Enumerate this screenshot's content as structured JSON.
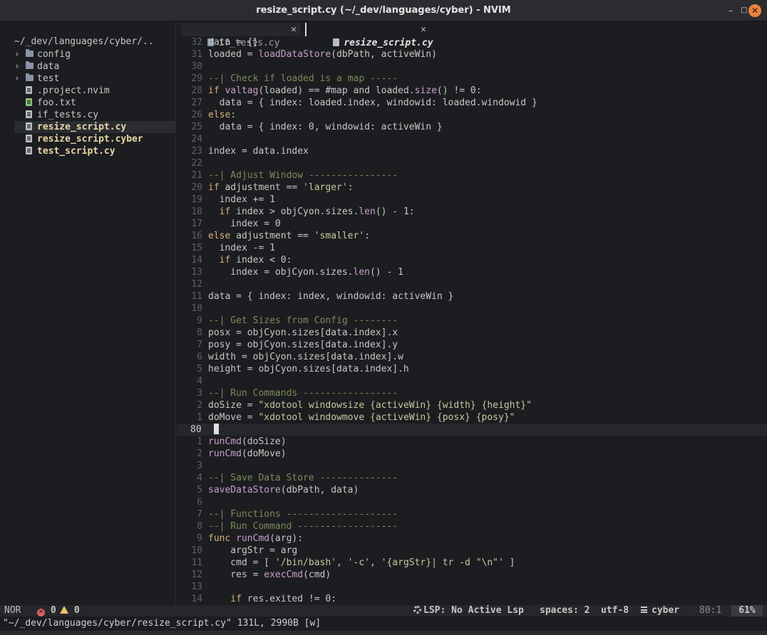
{
  "window": {
    "title": "resize_script.cy (~/_dev/languages/cyber) - NVIM",
    "min_glyph": "–",
    "max_glyph": "□",
    "close_glyph": "✕"
  },
  "tree": {
    "root": "~/_dev/languages/cyber/..",
    "items": [
      {
        "type": "folder",
        "label": "config",
        "chev": "›"
      },
      {
        "type": "folder",
        "label": "data",
        "chev": "›"
      },
      {
        "type": "folder",
        "label": "test",
        "chev": "›"
      },
      {
        "type": "file",
        "label": ".project.nvim",
        "style": "plain"
      },
      {
        "type": "file",
        "label": "foo.txt",
        "style": "plain"
      },
      {
        "type": "file",
        "label": "if_tests.cy",
        "style": "plain"
      },
      {
        "type": "file",
        "label": "resize_script.cy",
        "style": "bold"
      },
      {
        "type": "file",
        "label": "resize_script.cyber",
        "style": "bold"
      },
      {
        "type": "file",
        "label": "test_script.cy",
        "style": "bold"
      }
    ]
  },
  "tabs": [
    {
      "label": "if_tests.cy",
      "close": "✕"
    },
    {
      "label": "resize_script.cy",
      "close": "✕"
    }
  ],
  "editor": {
    "lines": [
      {
        "n": "32",
        "tokens": [
          [
            "plain",
            "data = {}"
          ]
        ]
      },
      {
        "n": "31",
        "tokens": [
          [
            "plain",
            "loaded = "
          ],
          [
            "fn",
            "loadDataStore"
          ],
          [
            "plain",
            "(dbPath, activeWin)"
          ]
        ]
      },
      {
        "n": "30",
        "tokens": []
      },
      {
        "n": "29",
        "tokens": [
          [
            "com",
            "--| Check if loaded is a map -----"
          ]
        ]
      },
      {
        "n": "28",
        "tokens": [
          [
            "kw",
            "if "
          ],
          [
            "fn",
            "valtag"
          ],
          [
            "plain",
            "(loaded) == #map and loaded."
          ],
          [
            "fn",
            "size"
          ],
          [
            "plain",
            "() != 0:"
          ]
        ]
      },
      {
        "n": "27",
        "tokens": [
          [
            "plain",
            "  data = { index: loaded.index, windowid: loaded.windowid }"
          ]
        ]
      },
      {
        "n": "26",
        "tokens": [
          [
            "kw",
            "else"
          ],
          [
            "plain",
            ":"
          ]
        ]
      },
      {
        "n": "25",
        "tokens": [
          [
            "plain",
            "  data = { index: 0, windowid: activeWin }"
          ]
        ]
      },
      {
        "n": "24",
        "tokens": []
      },
      {
        "n": "23",
        "tokens": [
          [
            "plain",
            "index = data.index"
          ]
        ]
      },
      {
        "n": "22",
        "tokens": []
      },
      {
        "n": "21",
        "tokens": [
          [
            "com",
            "--| Adjust Window ----------------"
          ]
        ]
      },
      {
        "n": "20",
        "tokens": [
          [
            "kw",
            "if "
          ],
          [
            "plain",
            "adjustment == "
          ],
          [
            "str",
            "'larger'"
          ],
          [
            "plain",
            ":"
          ]
        ]
      },
      {
        "n": "19",
        "tokens": [
          [
            "plain",
            "  index += 1"
          ]
        ]
      },
      {
        "n": "18",
        "tokens": [
          [
            "kw",
            "  if "
          ],
          [
            "plain",
            "index > objCyon.sizes."
          ],
          [
            "fn",
            "len"
          ],
          [
            "plain",
            "() - 1:"
          ]
        ]
      },
      {
        "n": "17",
        "tokens": [
          [
            "plain",
            "    index = 0"
          ]
        ]
      },
      {
        "n": "16",
        "tokens": [
          [
            "kw",
            "else "
          ],
          [
            "plain",
            "adjustment == "
          ],
          [
            "str",
            "'smaller'"
          ],
          [
            "plain",
            ":"
          ]
        ]
      },
      {
        "n": "15",
        "tokens": [
          [
            "plain",
            "  index -= 1"
          ]
        ]
      },
      {
        "n": "14",
        "tokens": [
          [
            "kw",
            "  if "
          ],
          [
            "plain",
            "index < 0:"
          ]
        ]
      },
      {
        "n": "13",
        "tokens": [
          [
            "plain",
            "    index = objCyon.sizes."
          ],
          [
            "fn",
            "len"
          ],
          [
            "plain",
            "() - 1"
          ]
        ]
      },
      {
        "n": "12",
        "tokens": []
      },
      {
        "n": "11",
        "tokens": [
          [
            "plain",
            "data = { index: index, windowid: activeWin }"
          ]
        ]
      },
      {
        "n": "10",
        "tokens": []
      },
      {
        "n": "9",
        "tokens": [
          [
            "com",
            "--| Get Sizes from Config --------"
          ]
        ]
      },
      {
        "n": "8",
        "tokens": [
          [
            "plain",
            "posx = objCyon.sizes[data.index].x"
          ]
        ]
      },
      {
        "n": "7",
        "tokens": [
          [
            "plain",
            "posy = objCyon.sizes[data.index].y"
          ]
        ]
      },
      {
        "n": "6",
        "tokens": [
          [
            "plain",
            "width = objCyon.sizes[data.index].w"
          ]
        ]
      },
      {
        "n": "5",
        "tokens": [
          [
            "plain",
            "height = objCyon.sizes[data.index].h"
          ]
        ]
      },
      {
        "n": "4",
        "tokens": []
      },
      {
        "n": "3",
        "tokens": [
          [
            "com",
            "--| Run Commands -----------------"
          ]
        ]
      },
      {
        "n": "2",
        "tokens": [
          [
            "plain",
            "doSize = "
          ],
          [
            "str",
            "\"xdotool windowsize {activeWin} {width} {height}\""
          ]
        ]
      },
      {
        "n": "1",
        "tokens": [
          [
            "plain",
            "doMove = "
          ],
          [
            "str",
            "\"xdotool windowmove {activeWin} {posx} {posy}\""
          ]
        ]
      },
      {
        "n": "80",
        "tokens": [],
        "cursor": true
      },
      {
        "n": "1",
        "tokens": [
          [
            "fn",
            "runCmd"
          ],
          [
            "plain",
            "(doSize)"
          ]
        ]
      },
      {
        "n": "2",
        "tokens": [
          [
            "fn",
            "runCmd"
          ],
          [
            "plain",
            "(doMove)"
          ]
        ]
      },
      {
        "n": "3",
        "tokens": []
      },
      {
        "n": "4",
        "tokens": [
          [
            "com",
            "--| Save Data Store --------------"
          ]
        ]
      },
      {
        "n": "5",
        "tokens": [
          [
            "fn",
            "saveDataStore"
          ],
          [
            "plain",
            "(dbPath, data)"
          ]
        ]
      },
      {
        "n": "6",
        "tokens": []
      },
      {
        "n": "7",
        "tokens": [
          [
            "com",
            "--| Functions --------------------"
          ]
        ]
      },
      {
        "n": "8",
        "tokens": [
          [
            "com",
            "--| Run Command ------------------"
          ]
        ]
      },
      {
        "n": "9",
        "tokens": [
          [
            "kw",
            "func "
          ],
          [
            "fn",
            "runCmd"
          ],
          [
            "plain",
            "(arg):"
          ]
        ]
      },
      {
        "n": "10",
        "tokens": [
          [
            "plain",
            "    argStr = arg"
          ]
        ]
      },
      {
        "n": "11",
        "tokens": [
          [
            "plain",
            "    cmd = [ "
          ],
          [
            "str",
            "'/bin/bash'"
          ],
          [
            "plain",
            ", "
          ],
          [
            "str",
            "'-c'"
          ],
          [
            "plain",
            ", "
          ],
          [
            "str",
            "'{argStr}| tr -d \"\\n\"'"
          ],
          [
            "plain",
            " ]"
          ]
        ]
      },
      {
        "n": "12",
        "tokens": [
          [
            "plain",
            "    res = "
          ],
          [
            "fn",
            "execCmd"
          ],
          [
            "plain",
            "(cmd)"
          ]
        ]
      },
      {
        "n": "13",
        "tokens": []
      },
      {
        "n": "14",
        "tokens": [
          [
            "kw",
            "    if "
          ],
          [
            "plain",
            "res.exited != 0:"
          ]
        ]
      }
    ]
  },
  "status": {
    "mode": "NOR",
    "errors": "0",
    "warnings": "0",
    "error_glyph": "✕",
    "lsp": "LSP: No Active Lsp",
    "spaces": "spaces: 2",
    "encoding": "utf-8",
    "filetype": "cyber",
    "position": "80:1",
    "percent": "61%"
  },
  "cmdline": {
    "text": "\"~/_dev/languages/cyber/resize_script.cy\" 131L, 2990B [w]"
  }
}
